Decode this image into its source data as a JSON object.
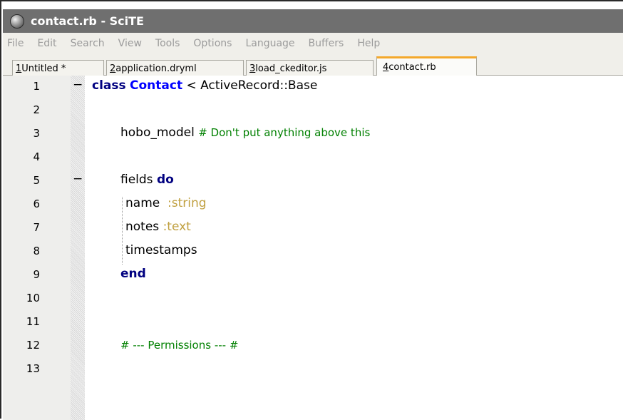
{
  "window": {
    "title": "contact.rb - SciTE"
  },
  "menu": [
    "File",
    "Edit",
    "Search",
    "View",
    "Tools",
    "Options",
    "Language",
    "Buffers",
    "Help"
  ],
  "tabs": [
    {
      "num": "1",
      "label": " Untitled *",
      "active": false
    },
    {
      "num": "2",
      "label": " application.dryml",
      "active": false
    },
    {
      "num": "3",
      "label": " load_ckeditor.js",
      "active": false
    },
    {
      "num": "4",
      "label": " contact.rb",
      "active": true
    }
  ],
  "editor": {
    "lines": [
      {
        "num": "1",
        "fold": "−"
      },
      {
        "num": "2",
        "fold": ""
      },
      {
        "num": "3",
        "fold": ""
      },
      {
        "num": "4",
        "fold": ""
      },
      {
        "num": "5",
        "fold": "−"
      },
      {
        "num": "6",
        "fold": ""
      },
      {
        "num": "7",
        "fold": ""
      },
      {
        "num": "8",
        "fold": ""
      },
      {
        "num": "9",
        "fold": ""
      },
      {
        "num": "10",
        "fold": ""
      },
      {
        "num": "11",
        "fold": ""
      },
      {
        "num": "12",
        "fold": ""
      },
      {
        "num": "13",
        "fold": ""
      }
    ],
    "code": {
      "l1_kw": "class",
      "l1_cls": "Contact",
      "l1_rest": " < ActiveRecord::Base",
      "l3_text": "hobo_model ",
      "l3_cmt": "# Don't put anything above this",
      "l5_text": "fields ",
      "l5_kw": "do",
      "l6_text": "name  ",
      "l6_sym": ":string",
      "l7_text": "notes ",
      "l7_sym": ":text",
      "l8_text": "timestamps",
      "l9_kw": "end",
      "l12_cmt": "# --- Permissions --- #"
    }
  },
  "colors": {
    "title_bar": "#6f6f6f",
    "keyword": "#000080",
    "class_name": "#0000ff",
    "comment": "#008000",
    "symbol": "#c0a040",
    "active_tab_accent": "#f4a82b"
  }
}
